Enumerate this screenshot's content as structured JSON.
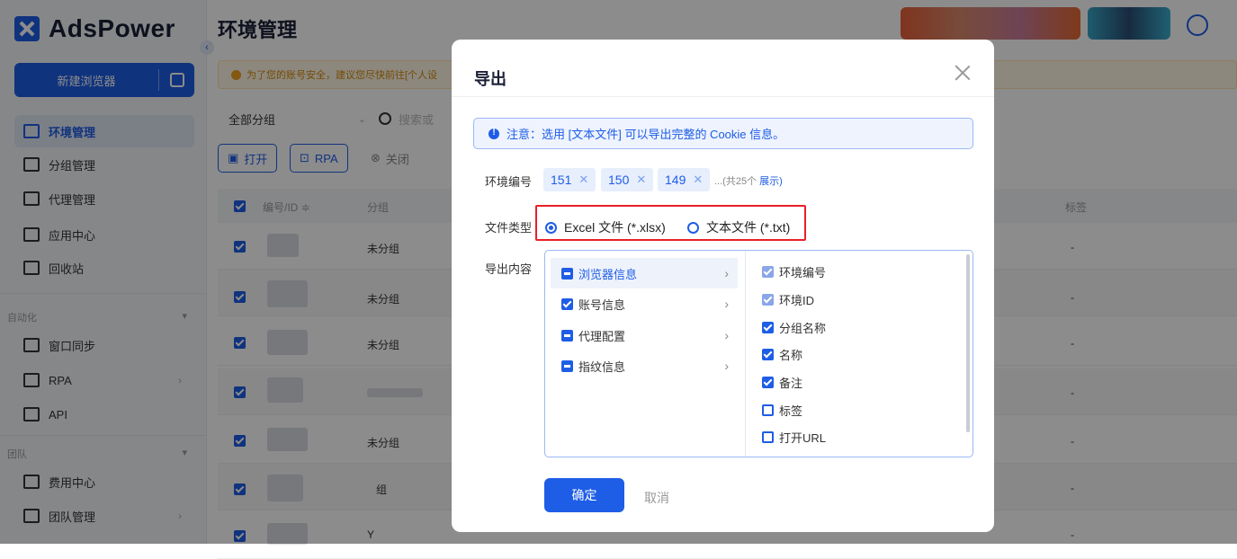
{
  "app": {
    "brand": "AdsPower",
    "page_title": "环境管理"
  },
  "sidebar": {
    "new_browser_label": "新建浏览器",
    "items": [
      {
        "label": "环境管理",
        "icon": "environment-icon",
        "active": true
      },
      {
        "label": "分组管理",
        "icon": "folder-icon"
      },
      {
        "label": "代理管理",
        "icon": "proxy-icon"
      },
      {
        "label": "应用中心",
        "icon": "app-center-icon"
      },
      {
        "label": "回收站",
        "icon": "trash-icon"
      }
    ],
    "section_auto": "自动化",
    "auto_items": [
      {
        "label": "窗口同步",
        "icon": "window-sync-icon"
      },
      {
        "label": "RPA",
        "icon": "rpa-icon"
      },
      {
        "label": "API",
        "icon": "api-icon"
      }
    ],
    "section_team": "团队",
    "team_items": [
      {
        "label": "费用中心",
        "icon": "billing-icon"
      },
      {
        "label": "团队管理",
        "icon": "team-icon"
      }
    ]
  },
  "main": {
    "notice": "为了您的账号安全，建议您尽快前往[个人设",
    "group_filter": "全部分组",
    "search_placeholder": "搜索或",
    "toolbar": {
      "open": "打开",
      "rpa": "RPA",
      "close": "关闭"
    },
    "columns": {
      "id": "编号/ID ≑",
      "group": "分组",
      "tags": "标签"
    },
    "rows": [
      {
        "group": "未分组",
        "tag": "-"
      },
      {
        "group": "未分组",
        "tag": "-"
      },
      {
        "group": "未分组",
        "tag": "-"
      },
      {
        "group": "",
        "tag": "-"
      },
      {
        "group": "未分组",
        "tag": "-"
      },
      {
        "group": "组",
        "tag": "-"
      },
      {
        "group": "Y",
        "tag": "-"
      }
    ]
  },
  "modal": {
    "title": "导出",
    "info": "注意：选用 [文本文件] 可以导出完整的 Cookie 信息。",
    "env_label": "环境编号",
    "env_tags": [
      "151",
      "150",
      "149"
    ],
    "env_more": "...(共25个",
    "env_show": "展示)",
    "filetype_label": "文件类型",
    "filetypes": [
      {
        "label": "Excel 文件 (*.xlsx)",
        "selected": true
      },
      {
        "label": "文本文件 (*.txt)",
        "selected": false
      }
    ],
    "content_label": "导出内容",
    "categories": [
      {
        "label": "浏览器信息",
        "state": "indeterminate",
        "selected": true
      },
      {
        "label": "账号信息",
        "state": "checked"
      },
      {
        "label": "代理配置",
        "state": "indeterminate"
      },
      {
        "label": "指纹信息",
        "state": "indeterminate"
      }
    ],
    "options": [
      {
        "label": "环境编号",
        "state": "disabled"
      },
      {
        "label": "环境ID",
        "state": "disabled"
      },
      {
        "label": "分组名称",
        "state": "checked"
      },
      {
        "label": "名称",
        "state": "checked"
      },
      {
        "label": "备注",
        "state": "checked"
      },
      {
        "label": "标签",
        "state": "unchecked"
      },
      {
        "label": "打开URL",
        "state": "unchecked"
      }
    ],
    "ok_label": "确定",
    "cancel_label": "取消"
  },
  "colors": {
    "accent": "#1e5de6",
    "highlight_box": "#e8202a"
  }
}
